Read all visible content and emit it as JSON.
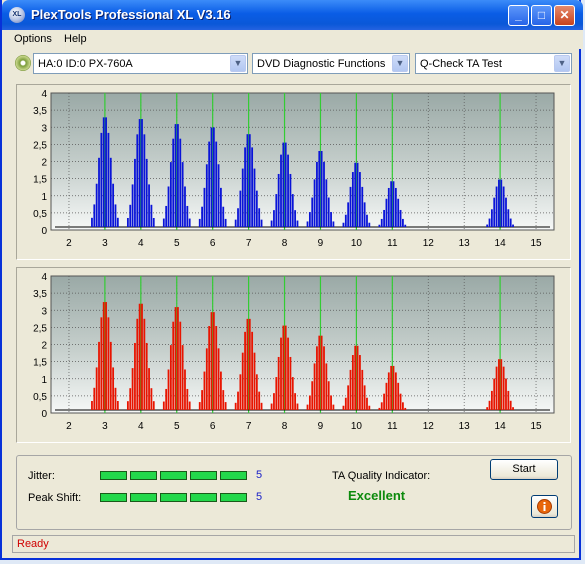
{
  "window": {
    "title": "PlexTools Professional XL V3.16",
    "icon_label": "XL",
    "controls": [
      "minimize",
      "maximize",
      "close"
    ]
  },
  "menu": [
    "Options",
    "Help"
  ],
  "toolbar": {
    "drive": "HA:0 ID:0  PX-760A",
    "function": "DVD Diagnostic Functions",
    "test": "Q-Check TA Test"
  },
  "charts": {
    "x_ticks": [
      "2",
      "3",
      "4",
      "5",
      "6",
      "7",
      "8",
      "9",
      "10",
      "11",
      "12",
      "13",
      "14",
      "15"
    ],
    "y_ticks": [
      "0",
      "0,5",
      "1",
      "1,5",
      "2",
      "2,5",
      "3",
      "3,5",
      "4"
    ],
    "marker_color": "#33cc33",
    "top_color": "#0a14d8",
    "bottom_color": "#e81400"
  },
  "chart_data": [
    {
      "type": "bar",
      "series": [
        {
          "name": "",
          "color": "#0a14d8",
          "peaks": [
            {
              "center": 3,
              "height": 3.35
            },
            {
              "center": 4,
              "height": 3.3
            },
            {
              "center": 5,
              "height": 3.15
            },
            {
              "center": 6,
              "height": 3.05
            },
            {
              "center": 7,
              "height": 2.85
            },
            {
              "center": 8,
              "height": 2.6
            },
            {
              "center": 9,
              "height": 2.35
            },
            {
              "center": 10,
              "height": 2.0
            },
            {
              "center": 11,
              "height": 1.45
            },
            {
              "center": 14,
              "height": 1.5
            }
          ]
        }
      ],
      "xlim": [
        1.5,
        15.5
      ],
      "ylim": [
        0,
        4
      ],
      "markers": [
        3,
        4,
        5,
        6,
        7,
        8,
        9,
        10,
        11,
        14
      ]
    },
    {
      "type": "bar",
      "series": [
        {
          "name": "",
          "color": "#e81400",
          "peaks": [
            {
              "center": 3,
              "height": 3.3
            },
            {
              "center": 4,
              "height": 3.25
            },
            {
              "center": 5,
              "height": 3.15
            },
            {
              "center": 6,
              "height": 3.0
            },
            {
              "center": 7,
              "height": 2.8
            },
            {
              "center": 8,
              "height": 2.6
            },
            {
              "center": 9,
              "height": 2.3
            },
            {
              "center": 10,
              "height": 2.0
            },
            {
              "center": 11,
              "height": 1.4
            },
            {
              "center": 14,
              "height": 1.6
            }
          ]
        }
      ],
      "xlim": [
        1.5,
        15.5
      ],
      "ylim": [
        0,
        4
      ],
      "markers": [
        3,
        4,
        5,
        6,
        7,
        8,
        9,
        10,
        11,
        14
      ]
    }
  ],
  "results": {
    "jitter_label": "Jitter:",
    "jitter_value": "5",
    "jitter_level": 5,
    "peak_label": "Peak Shift:",
    "peak_value": "5",
    "peak_level": 5,
    "ta_label": "TA Quality Indicator:",
    "ta_value": "Excellent"
  },
  "buttons": {
    "start": "Start",
    "info_icon": "info-icon"
  },
  "status": "Ready"
}
